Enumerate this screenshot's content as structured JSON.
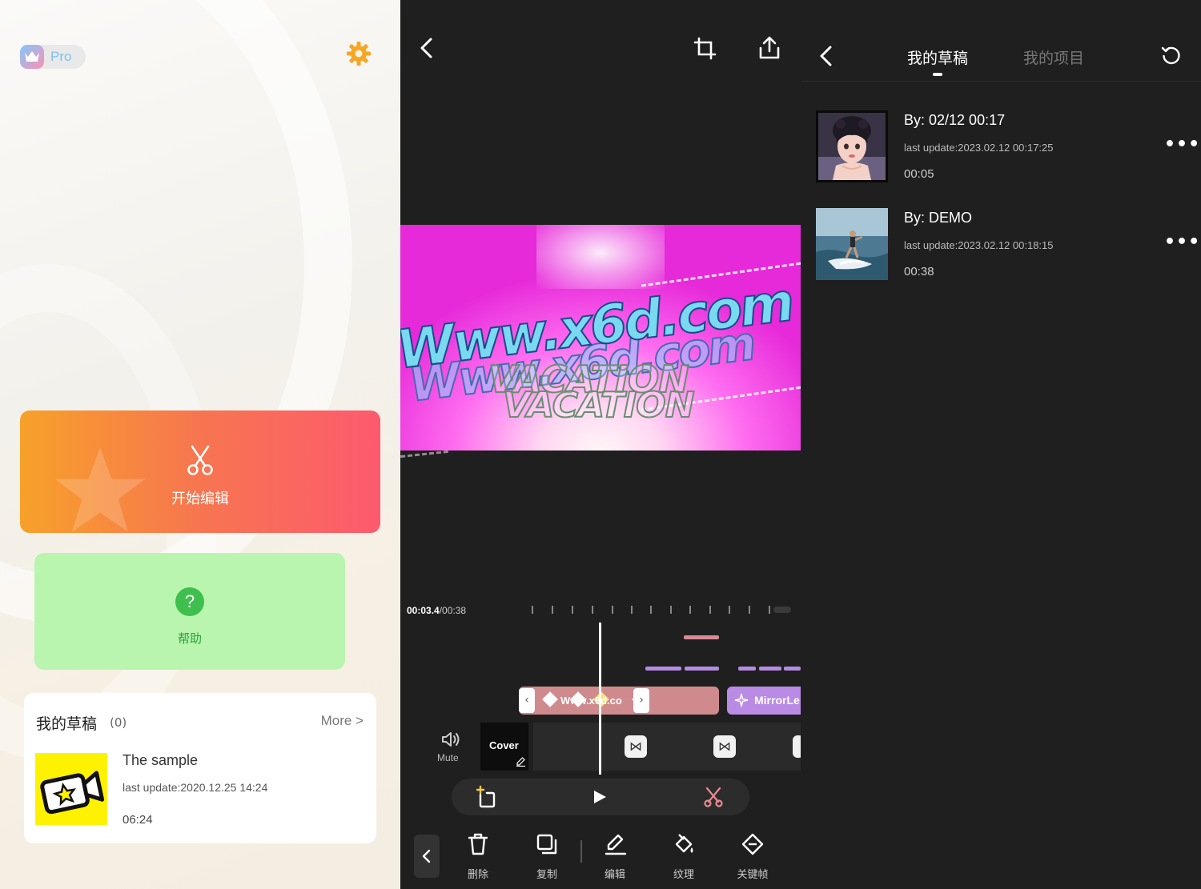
{
  "home": {
    "logo_text": "Pro",
    "start_label": "开始编辑",
    "help_label": "帮助",
    "help_glyph": "?",
    "drafts": {
      "title": "我的草稿",
      "count": "(0)",
      "more_label": "More >",
      "sample": {
        "name": "The sample",
        "last_update": "last update:2020.12.25 14:24",
        "duration": "06:24"
      }
    }
  },
  "editor": {
    "preview": {
      "watermark_line1": "Www.x6d.com",
      "watermark_line2": "Www.x6d.com",
      "vacation_line1": "VACATION",
      "vacation_line2": "VACATION"
    },
    "timeline": {
      "current_time": "00:03.4",
      "total_time": "/00:38",
      "text_clip_label": "Www.x6d.co",
      "effect_clip_label": "MirrorLe",
      "mute_label": "Mute",
      "cover_label": "Cover",
      "transition_glyph": "⋈"
    },
    "toolbar": {
      "items": [
        {
          "label": "删除"
        },
        {
          "label": "复制"
        },
        {
          "label": "编辑"
        },
        {
          "label": "纹理"
        },
        {
          "label": "关键帧"
        }
      ]
    }
  },
  "projects": {
    "tabs": [
      {
        "label": "我的草稿",
        "active": true
      },
      {
        "label": "我的项目",
        "active": false
      }
    ],
    "items": [
      {
        "title": "By: 02/12 00:17",
        "last_update": "last update:2023.02.12 00:17:25",
        "duration": "00:05"
      },
      {
        "title": "By: DEMO",
        "last_update": "last update:2023.02.12 00:18:15",
        "duration": "00:38"
      }
    ],
    "menu_glyph": "•••"
  },
  "colors": {
    "start_gradient": [
      "#f7a12a",
      "#fd5a6e"
    ],
    "help_bg": "#b9f5ae",
    "help_accent": "#3fbf4e",
    "editor_bg": "#1f1f1f",
    "text_clip": "#cf8a8e",
    "effect_clip": "#b98be4",
    "lane_pink": "#d98c96",
    "lane_purple": "#b48be0",
    "scissor_accent": "#e88a93"
  },
  "icons": [
    "crown-icon",
    "gear-icon",
    "scissors-icon",
    "star-icon",
    "help-icon",
    "video-camera-star-icon",
    "back-arrow-icon",
    "crop-icon",
    "export-icon",
    "speaker-icon",
    "edit-pencil-icon",
    "add-clip-icon",
    "play-icon",
    "trash-icon",
    "copy-icon",
    "pen-icon",
    "paint-bucket-icon",
    "keyframe-diamond-icon",
    "refresh-icon",
    "more-icon"
  ]
}
